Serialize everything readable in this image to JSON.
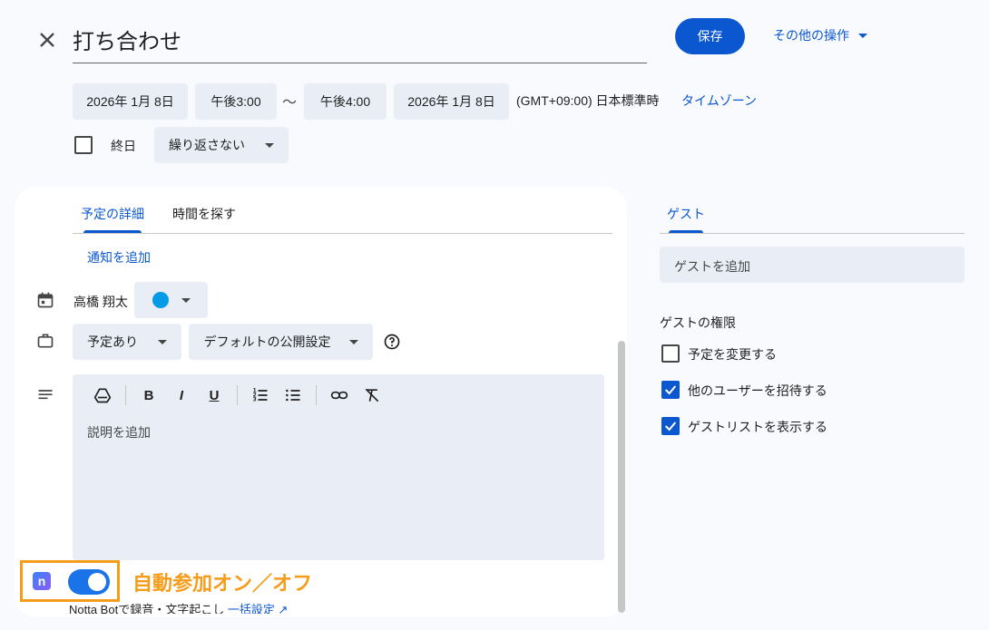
{
  "header": {
    "title_value": "打ち合わせ",
    "save_label": "保存",
    "more_actions_label": "その他の操作"
  },
  "datetime": {
    "start_date": "2026年 1月 8日",
    "start_time": "午後3:00",
    "separator": "〜",
    "end_time": "午後4:00",
    "end_date": "2026年 1月 8日",
    "timezone_text": "(GMT+09:00) 日本標準時",
    "timezone_link": "タイムゾーン"
  },
  "options": {
    "all_day_label": "終日",
    "all_day_checked": false,
    "repeat_value": "繰り返さない"
  },
  "details": {
    "tabs": [
      "予定の詳細",
      "時間を探す"
    ],
    "active_tab": "予定の詳細",
    "add_notification": "通知を追加",
    "owner_name": "高橋 翔太",
    "event_color": "#039be5",
    "availability_value": "予定あり",
    "visibility_value": "デフォルトの公開設定",
    "description_placeholder": "説明を追加"
  },
  "notta": {
    "toggle_on": true,
    "annotation": "自動参加オン／オフ",
    "description": "Notta Botで録音・文字起こし",
    "bulk_link": "一括設定"
  },
  "guests": {
    "tab_label": "ゲスト",
    "add_placeholder": "ゲストを追加",
    "permissions_heading": "ゲストの権限",
    "permissions": [
      {
        "label": "予定を変更する",
        "checked": false
      },
      {
        "label": "他のユーザーを招待する",
        "checked": true
      },
      {
        "label": "ゲストリストを表示する",
        "checked": true
      }
    ]
  },
  "colors": {
    "accent": "#0b57d0",
    "annotation": "#f59c1a"
  }
}
